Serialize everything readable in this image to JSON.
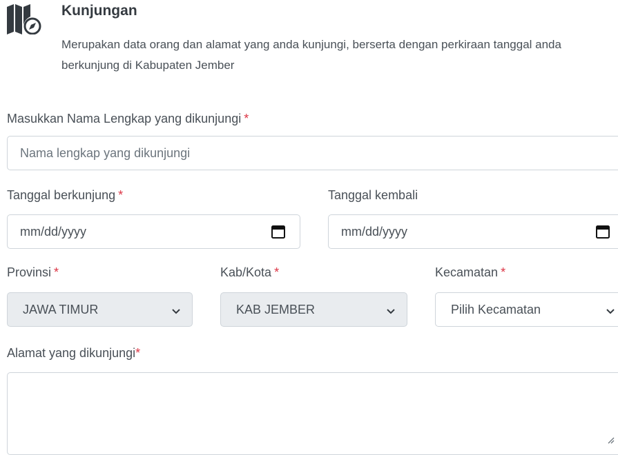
{
  "header": {
    "icon": "map-compass-icon",
    "title": "Kunjungan",
    "description": "Merupakan data orang dan alamat yang anda kunjungi, berserta dengan perkiraan tanggal anda berkunjung di Kabupaten Jember"
  },
  "form": {
    "required_marker": "*",
    "nama": {
      "label": "Masukkan Nama Lengkap yang dikunjungi",
      "placeholder": "Nama lengkap yang dikunjungi",
      "value": ""
    },
    "tanggal_berkunjung": {
      "label": "Tanggal berkunjung",
      "value": "mm/dd/yyyy",
      "icon": "calendar-icon"
    },
    "tanggal_kembali": {
      "label": "Tanggal kembali",
      "value": "mm/dd/yyyy",
      "icon": "calendar-icon"
    },
    "provinsi": {
      "label": "Provinsi",
      "selected": "JAWA TIMUR",
      "disabled": true
    },
    "kab_kota": {
      "label": "Kab/Kota",
      "selected": "KAB JEMBER",
      "disabled": true
    },
    "kecamatan": {
      "label": "Kecamatan",
      "selected": "Pilih Kecamatan",
      "disabled": false
    },
    "alamat": {
      "label": "Alamat yang dikunjungi",
      "value": ""
    }
  },
  "colors": {
    "required": "#dc3545",
    "border": "#ced4da",
    "disabled_bg": "#e9ecef",
    "text": "#495057"
  }
}
